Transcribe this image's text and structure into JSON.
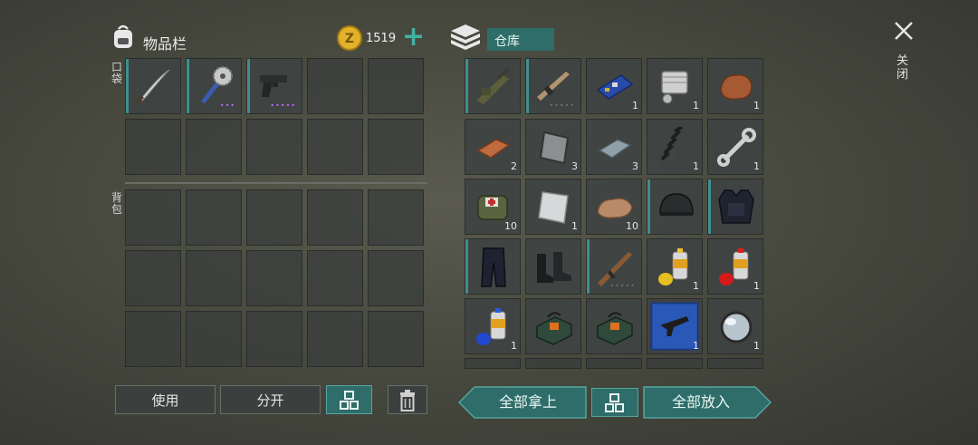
{
  "inventory": {
    "title": "物品栏",
    "currency": "1519",
    "pocket_label": "口袋",
    "bag_label": "背包",
    "pocket_items": [
      {
        "name": "machete",
        "dots": ""
      },
      {
        "name": "saw-mace",
        "dots": "•••"
      },
      {
        "name": "pistol",
        "dots": "•••••"
      }
    ]
  },
  "storage": {
    "title": "仓库",
    "items": [
      {
        "name": "grenade-launcher-rifle",
        "count": "",
        "dots": ""
      },
      {
        "name": "assault-rifle",
        "count": "",
        "dots": "•••••"
      },
      {
        "name": "circuit-board",
        "count": "1",
        "dots": ""
      },
      {
        "name": "engine-part",
        "count": "1",
        "dots": ""
      },
      {
        "name": "copper-ore",
        "count": "1",
        "dots": ""
      },
      {
        "name": "copper-bar",
        "count": "2",
        "dots": ""
      },
      {
        "name": "metal-plate",
        "count": "3",
        "dots": ""
      },
      {
        "name": "steel-bar",
        "count": "3",
        "dots": ""
      },
      {
        "name": "spring",
        "count": "1",
        "dots": ""
      },
      {
        "name": "wrench",
        "count": "1",
        "dots": ""
      },
      {
        "name": "medical-bag",
        "count": "10",
        "dots": ""
      },
      {
        "name": "aluminum-sheet",
        "count": "1",
        "dots": ""
      },
      {
        "name": "stone",
        "count": "10",
        "dots": ""
      },
      {
        "name": "tactical-helmet",
        "count": "",
        "dots": ""
      },
      {
        "name": "tactical-vest",
        "count": "",
        "dots": ""
      },
      {
        "name": "tactical-pants",
        "count": "",
        "dots": ""
      },
      {
        "name": "combat-boots",
        "count": "",
        "dots": ""
      },
      {
        "name": "ak-rifle",
        "count": "",
        "dots": "•••••"
      },
      {
        "name": "spray-paint-yellow",
        "count": "1",
        "dots": ""
      },
      {
        "name": "spray-paint-red",
        "count": "1",
        "dots": ""
      },
      {
        "name": "spray-paint-blue",
        "count": "1",
        "dots": ""
      },
      {
        "name": "explosive-charge",
        "count": "",
        "dots": ""
      },
      {
        "name": "explosive-charge",
        "count": "",
        "dots": ""
      },
      {
        "name": "smg-blueprint",
        "count": "1",
        "dots": ""
      },
      {
        "name": "lens",
        "count": "1",
        "dots": ""
      }
    ]
  },
  "buttons": {
    "use": "使用",
    "split": "分开",
    "take_all": "全部拿上",
    "put_all": "全部放入",
    "close": "关闭"
  },
  "colors": {
    "accent_teal": "#2f6d6a",
    "slot_bar": "#3f8f8f",
    "coin": "#e3b22b"
  }
}
